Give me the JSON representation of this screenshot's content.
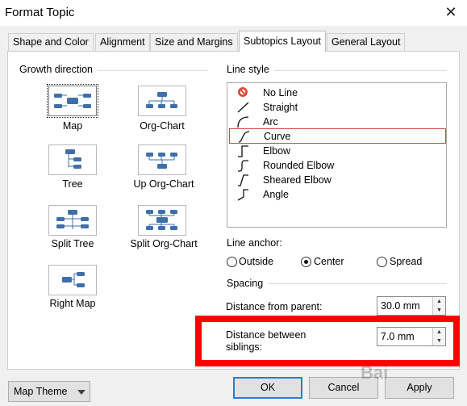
{
  "window": {
    "title": "Format Topic",
    "close_glyph": "✕"
  },
  "tabs": [
    {
      "label": "Shape and Color",
      "active": false
    },
    {
      "label": "Alignment",
      "active": false
    },
    {
      "label": "Size and Margins",
      "active": false
    },
    {
      "label": "Subtopics Layout",
      "active": true
    },
    {
      "label": "General Layout",
      "active": false
    }
  ],
  "growth": {
    "label": "Growth direction",
    "items": [
      {
        "label": "Map",
        "icon": "map-layout-icon",
        "selected": true
      },
      {
        "label": "Org-Chart",
        "icon": "org-chart-layout-icon",
        "selected": false
      },
      {
        "label": "Tree",
        "icon": "tree-layout-icon",
        "selected": false
      },
      {
        "label": "Up Org-Chart",
        "icon": "up-org-chart-layout-icon",
        "selected": false
      },
      {
        "label": "Split Tree",
        "icon": "split-tree-layout-icon",
        "selected": false
      },
      {
        "label": "Split Org-Chart",
        "icon": "split-org-chart-layout-icon",
        "selected": false
      },
      {
        "label": "Right Map",
        "icon": "right-map-layout-icon",
        "selected": false
      }
    ]
  },
  "line_style": {
    "label": "Line style",
    "items": [
      {
        "label": "No Line",
        "icon": "no-line-icon"
      },
      {
        "label": "Straight",
        "icon": "straight-line-icon"
      },
      {
        "label": "Arc",
        "icon": "arc-line-icon"
      },
      {
        "label": "Curve",
        "icon": "curve-line-icon"
      },
      {
        "label": "Elbow",
        "icon": "elbow-line-icon"
      },
      {
        "label": "Rounded Elbow",
        "icon": "rounded-elbow-line-icon"
      },
      {
        "label": "Sheared Elbow",
        "icon": "sheared-elbow-line-icon"
      },
      {
        "label": "Angle",
        "icon": "angle-line-icon"
      }
    ],
    "selected": "Curve"
  },
  "line_anchor": {
    "label": "Line anchor:",
    "options": [
      {
        "label": "Outside",
        "checked": false
      },
      {
        "label": "Center",
        "checked": true
      },
      {
        "label": "Spread",
        "checked": false
      }
    ]
  },
  "spacing": {
    "label": "Spacing",
    "parent_label": "Distance from parent:",
    "parent_value": "30.0 mm",
    "siblings_label_line1": "Distance between",
    "siblings_label_line2": "siblings:",
    "siblings_value": "7.0 mm"
  },
  "footer": {
    "map_theme_label": "Map Theme",
    "ok_label": "OK",
    "cancel_label": "Cancel",
    "apply_label": "Apply"
  },
  "watermark": "Bai",
  "colors": {
    "highlight": "#ff0000",
    "selected_row_border": "#cf4646",
    "default_button_border": "#2b7ad7",
    "node_blue": "#3f6fa8"
  }
}
